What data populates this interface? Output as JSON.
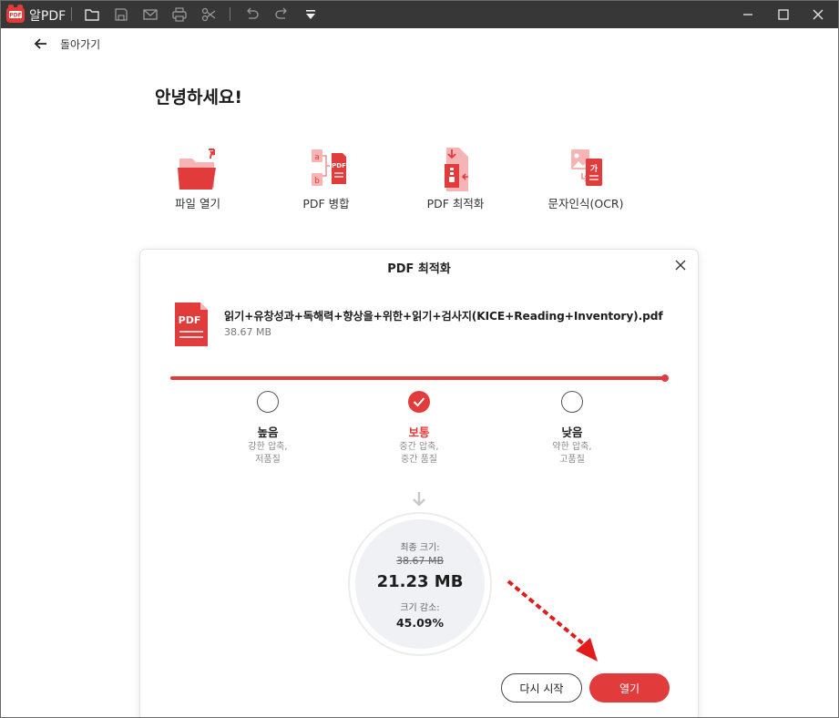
{
  "app": {
    "name": "알PDF"
  },
  "toolbar": {
    "icons": [
      "folder-icon",
      "save-icon",
      "mail-icon",
      "print-icon",
      "scissors-icon",
      "undo-icon",
      "redo-icon",
      "dropdown-icon"
    ]
  },
  "window_controls": [
    "minimize",
    "maximize",
    "close"
  ],
  "nav": {
    "back_label": "돌아가기"
  },
  "greeting": "안녕하세요!",
  "features": [
    {
      "label": "파일 열기",
      "icon": "open-folder-icon"
    },
    {
      "label": "PDF 병합",
      "icon": "merge-pdf-icon"
    },
    {
      "label": "PDF 최적화",
      "icon": "optimize-pdf-icon"
    },
    {
      "label": "문자인식(OCR)",
      "icon": "ocr-icon"
    }
  ],
  "dialog": {
    "title": "PDF 최적화",
    "file": {
      "icon_text": "PDF",
      "name": "읽기+유창성과+독해력+향상을+위한+읽기+검사지(KICE+Reading+Inventory).pdf",
      "size": "38.67 MB"
    },
    "options": [
      {
        "title": "높음",
        "desc_line1": "강한 압축,",
        "desc_line2": "저품질",
        "selected": false
      },
      {
        "title": "보통",
        "desc_line1": "중간 압축,",
        "desc_line2": "중간 품질",
        "selected": true
      },
      {
        "title": "낮음",
        "desc_line1": "약한 압축,",
        "desc_line2": "고품질",
        "selected": false
      }
    ],
    "result": {
      "final_label": "최종 크기:",
      "original_size": "38.67 MB",
      "final_size": "21.23 MB",
      "reduction_label": "크기 감소:",
      "reduction_percent": "45.09%"
    },
    "buttons": {
      "restart": "다시 시작",
      "open": "열기"
    }
  },
  "colors": {
    "titlebar": "#373737",
    "accent": "#e23b3b",
    "result_bg": "#f0f1f5"
  }
}
